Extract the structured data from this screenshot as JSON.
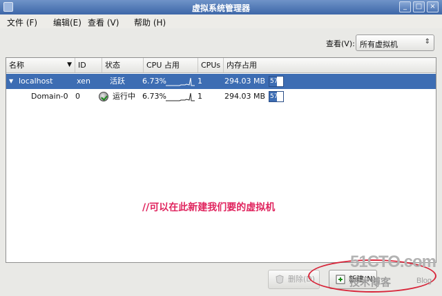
{
  "window": {
    "title": "虚拟系统管理器",
    "controls": [
      "_",
      "□",
      "×"
    ]
  },
  "menu": [
    {
      "label": "文件 (F)"
    },
    {
      "label": "编辑(E)"
    },
    {
      "label": "查看 (V)"
    },
    {
      "label": "帮助 (H)"
    }
  ],
  "view": {
    "label": "查看(V):",
    "selected": "所有虚拟机"
  },
  "table": {
    "columns": [
      "名称",
      "ID",
      "状态",
      "CPU 占用",
      "CPUs",
      "内存占用"
    ],
    "rows": [
      {
        "name": "localhost",
        "id": "xen",
        "status": "活跃",
        "cpu": "6.73%",
        "cpus": "1",
        "memory": "294.03 MB",
        "mem_pct": "57",
        "mem_fraction": 0.57,
        "expander": "▼"
      },
      {
        "name": "Domain-0",
        "id": "0",
        "status": "运行中",
        "cpu": "6.73%",
        "cpus": "1",
        "memory": "294.03 MB",
        "mem_pct": "57",
        "mem_fraction": 0.57
      }
    ]
  },
  "annotation": "//可以在此新建我们要的虚拟机",
  "buttons": {
    "delete": "删除(D)",
    "new": "新建(N)"
  },
  "watermark": {
    "main": "51CTO.com",
    "sub": "技术博客",
    "blog": "Blog"
  }
}
